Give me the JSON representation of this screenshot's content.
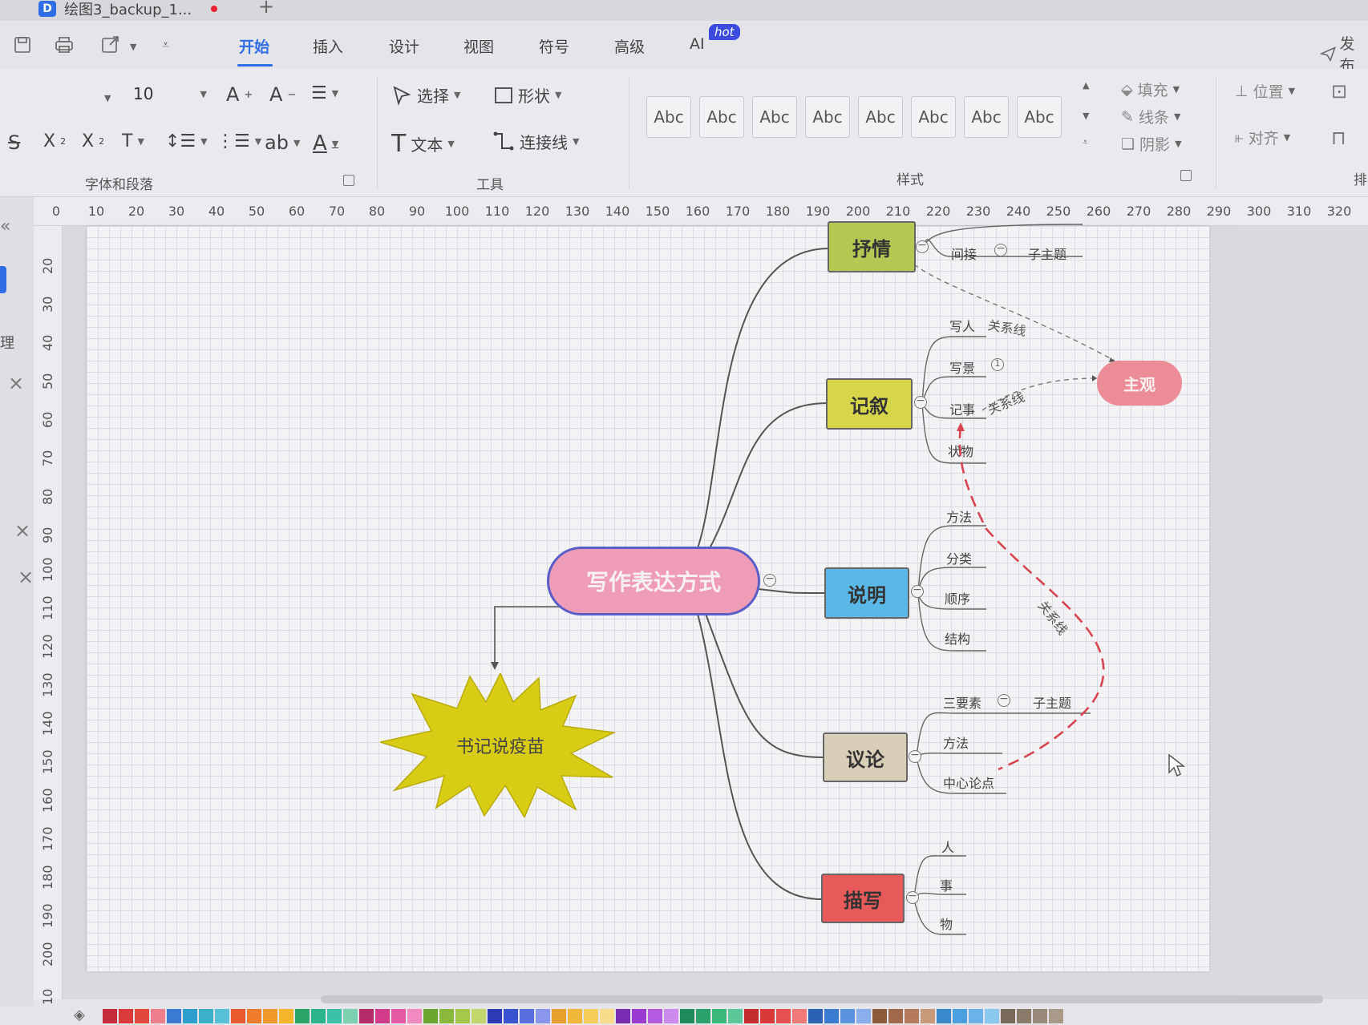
{
  "window": {
    "file_tab": "绘图3_backup_1...",
    "app_logo": "D"
  },
  "menu": {
    "tabs": [
      "开始",
      "插入",
      "设计",
      "视图",
      "符号",
      "高级",
      "AI"
    ],
    "hot_badge": "hot",
    "publish": "发布"
  },
  "ribbon": {
    "font_size": "10",
    "select_label": "选择",
    "shape_label": "形状",
    "text_label": "文本",
    "connector_label": "连接线",
    "style_presets": [
      "Abc",
      "Abc",
      "Abc",
      "Abc",
      "Abc",
      "Abc",
      "Abc",
      "Abc"
    ],
    "fill_label": "填充",
    "line_label": "线条",
    "shadow_label": "阴影",
    "position_label": "位置",
    "align_label": "对齐",
    "group_font": "字体和段落",
    "group_tools": "工具",
    "group_style": "样式",
    "group_arrange": "排"
  },
  "left_panel": {
    "label": "理"
  },
  "ruler": {
    "h_ticks": [
      "0",
      "10",
      "20",
      "30",
      "40",
      "50",
      "60",
      "70",
      "80",
      "90",
      "100",
      "110",
      "120",
      "130",
      "140",
      "150",
      "160",
      "170",
      "180",
      "190",
      "200",
      "210",
      "220",
      "230",
      "240",
      "250",
      "260",
      "270",
      "280",
      "290",
      "300",
      "310",
      "320"
    ],
    "v_ticks": [
      "20",
      "30",
      "40",
      "50",
      "60",
      "70",
      "80",
      "90",
      "100",
      "110",
      "120",
      "130",
      "140",
      "150",
      "160",
      "170",
      "180",
      "190",
      "200",
      "10"
    ]
  },
  "mindmap": {
    "central": "写作表达方式",
    "star_note": "书记说疫苗",
    "subjective": "主观",
    "branches": {
      "lyric": {
        "label": "抒情",
        "color": "#b3c953",
        "children": [
          "间接"
        ],
        "sub_topic": "子主题"
      },
      "narrative": {
        "label": "记叙",
        "color": "#d7d64b",
        "children": [
          "写人",
          "写景",
          "记事",
          "状物"
        ]
      },
      "exposition": {
        "label": "说明",
        "color": "#5ab8e6",
        "children": [
          "方法",
          "分类",
          "顺序",
          "结构"
        ]
      },
      "argument": {
        "label": "议论",
        "color": "#d9cfb8",
        "children": [
          "三要素",
          "方法",
          "中心论点"
        ],
        "sub_topic": "子主题"
      },
      "description": {
        "label": "描写",
        "color": "#e85a5a",
        "children": [
          "人",
          "事",
          "物"
        ]
      }
    },
    "relation_label": "关系线",
    "marker_one": "1"
  },
  "palette": [
    "#c62c3a",
    "#d93a3a",
    "#e2483c",
    "#ef7f8c",
    "#3a7bd5",
    "#2c9fcf",
    "#3ab0c9",
    "#58c0d8",
    "#e65a2c",
    "#ef7c2c",
    "#f09a2c",
    "#f2b52c",
    "#2ca56a",
    "#2cb48a",
    "#3ac0a4",
    "#7dd0b0",
    "#b42c6a",
    "#d23a8a",
    "#e45aa2",
    "#f08ac0",
    "#6aa52c",
    "#8ab83a",
    "#a6c84a",
    "#c2d86a",
    "#2c3ab4",
    "#3a52d0",
    "#5a6ee0",
    "#8a96ec",
    "#e8a02c",
    "#f0b83a",
    "#f4cc5a",
    "#f8dc8a",
    "#7a2cb4",
    "#9a3ad0",
    "#b45ae0",
    "#cc8aec",
    "#1f8a5a",
    "#2aa06a",
    "#3ab87a",
    "#5ac89a",
    "#c42c2c",
    "#d83a3a",
    "#e85050",
    "#f07a7a",
    "#2c62b4",
    "#3a7ad0",
    "#5a92e0",
    "#8aaeec",
    "#8a5a3a",
    "#a06a4a",
    "#b47a5a",
    "#c89a7a",
    "#3a8ad0",
    "#4aa0e0",
    "#6ab4ea",
    "#8ac8f0",
    "#7a6a5a",
    "#8a7a6a",
    "#9a8a7a",
    "#aa9a8a"
  ]
}
